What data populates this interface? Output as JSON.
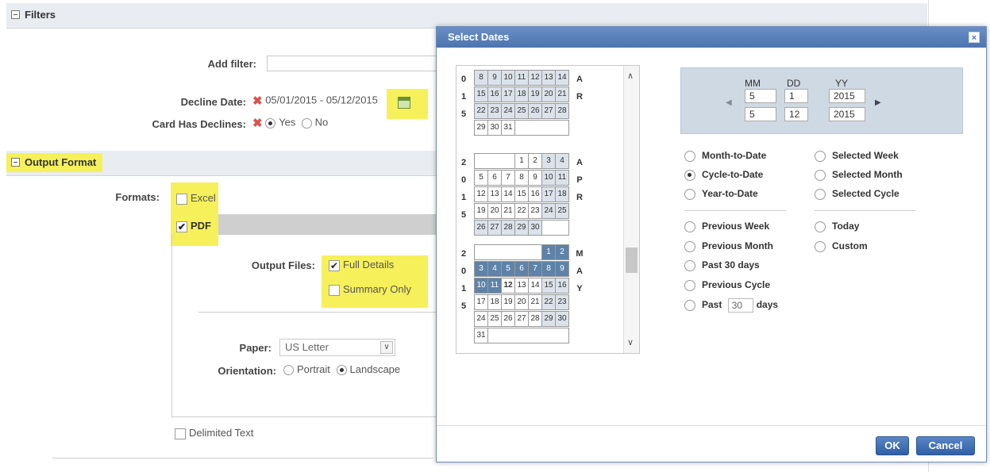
{
  "filters": {
    "header": "Filters",
    "add_filter_label": "Add filter:",
    "decline_date_label": "Decline Date:",
    "decline_date_value": "05/01/2015 - 05/12/2015",
    "card_has_declines_label": "Card Has Declines:",
    "yes_label": "Yes",
    "no_label": "No"
  },
  "output": {
    "header": "Output Format",
    "formats_label": "Formats:",
    "excel_label": "Excel",
    "pdf_label": "PDF",
    "output_files_label": "Output Files:",
    "full_details_label": "Full Details",
    "summary_only_label": "Summary Only",
    "paper_label": "Paper:",
    "paper_value": "US Letter",
    "orientation_label": "Orientation:",
    "portrait_label": "Portrait",
    "landscape_label": "Landscape",
    "delimited_label": "Delimited Text"
  },
  "dialog": {
    "title": "Select Dates",
    "close": "×",
    "mm_header": "MM",
    "dd_header": "DD",
    "yy_header": "YY",
    "from": {
      "mm": "5",
      "dd": "1",
      "yy": "2015"
    },
    "to": {
      "mm": "5",
      "dd": "12",
      "yy": "2015"
    },
    "options_left_1": [
      "Month-to-Date",
      "Cycle-to-Date",
      "Year-to-Date"
    ],
    "options_right_1": [
      "Selected Week",
      "Selected Month",
      "Selected Cycle"
    ],
    "options_left_2": [
      "Previous Week",
      "Previous Month",
      "Past 30 days",
      "Previous Cycle"
    ],
    "options_right_2": [
      "Today",
      "Custom"
    ],
    "past_label": "Past",
    "past_value": "30",
    "days_label": "days",
    "ok_label": "OK",
    "cancel_label": "Cancel",
    "selected_option": "Cycle-to-Date"
  },
  "calendar": {
    "march": {
      "year": [
        "0",
        "1",
        "5"
      ],
      "month": [
        "A",
        "R"
      ],
      "rows": [
        [
          "8",
          "9",
          "10",
          "11",
          "12",
          "13",
          "14"
        ],
        [
          "15",
          "16",
          "17",
          "18",
          "19",
          "20",
          "21"
        ],
        [
          "22",
          "23",
          "24",
          "25",
          "26",
          "27",
          "28"
        ],
        [
          "29",
          "30",
          "31"
        ]
      ]
    },
    "april": {
      "year": [
        "2",
        "0",
        "1",
        "5"
      ],
      "month": [
        "A",
        "P",
        "R"
      ],
      "rows": [
        [
          "1",
          "2",
          "3",
          "4"
        ],
        [
          "5",
          "6",
          "7",
          "8",
          "9",
          "10",
          "11"
        ],
        [
          "12",
          "13",
          "14",
          "15",
          "16",
          "17",
          "18"
        ],
        [
          "19",
          "20",
          "21",
          "22",
          "23",
          "24",
          "25"
        ],
        [
          "26",
          "27",
          "28",
          "29",
          "30"
        ]
      ]
    },
    "may": {
      "year": [
        "2",
        "0",
        "1",
        "5"
      ],
      "month": [
        "M",
        "A",
        "Y"
      ],
      "rows": [
        [
          "1",
          "2"
        ],
        [
          "3",
          "4",
          "5",
          "6",
          "7",
          "8",
          "9"
        ],
        [
          "10",
          "11",
          "12",
          "13",
          "14",
          "15",
          "16"
        ],
        [
          "17",
          "18",
          "19",
          "20",
          "21",
          "22",
          "23"
        ],
        [
          "24",
          "25",
          "26",
          "27",
          "28",
          "29",
          "30"
        ],
        [
          "31"
        ]
      ]
    }
  },
  "colors": {
    "highlight": "#f6f05a",
    "selected_day": "#5f83a8",
    "week_day": "#dbe2ea",
    "dialog_title": "#4d74ae"
  }
}
